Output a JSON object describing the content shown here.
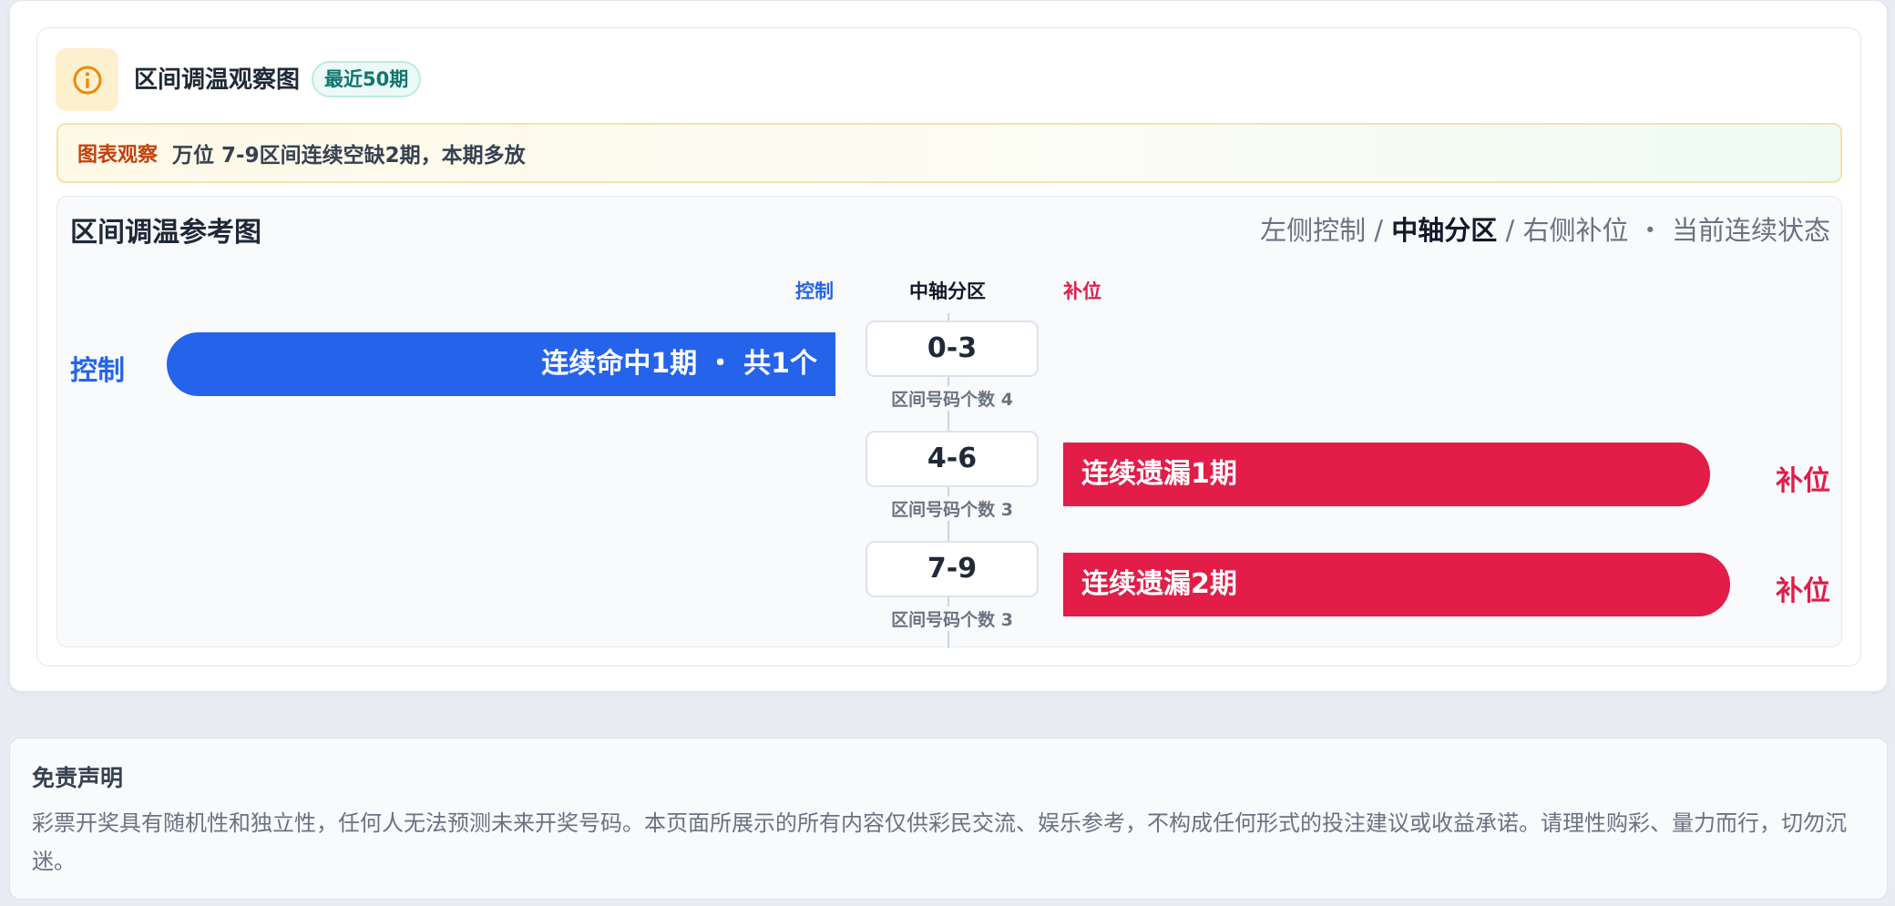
{
  "header": {
    "title": "区间调温观察图",
    "badge": "最近50期"
  },
  "observation": {
    "label": "图表观察",
    "text": "万位 7-9区间连续空缺2期，本期多放"
  },
  "chart": {
    "title": "区间调温参考图",
    "legend": {
      "left": "左侧控制",
      "sep1": " / ",
      "middle": "中轴分区",
      "sep2": " / ",
      "right": "右侧补位",
      "dot": " ・ ",
      "state": "当前连续状态"
    },
    "column_heads": {
      "control": "控制",
      "axis": "中轴分区",
      "fill": "补位"
    },
    "colors": {
      "control": "#2563eb",
      "fill": "#e11d48"
    }
  },
  "chart_data": {
    "type": "bar",
    "categories": [
      "0-3",
      "4-6",
      "7-9"
    ],
    "rows": [
      {
        "range": "0-3",
        "sub": "区间号码个数 4",
        "side": "left",
        "row_label": "控制",
        "bar_text": "连续命中1期 ・ 共1个"
      },
      {
        "range": "4-6",
        "sub": "区间号码个数 3",
        "side": "right",
        "row_label": "补位",
        "bar_text": "连续遗漏1期"
      },
      {
        "range": "7-9",
        "sub": "区间号码个数 3",
        "side": "right",
        "row_label": "补位",
        "bar_text": "连续遗漏2期"
      }
    ]
  },
  "disclaimer": {
    "title": "免责声明",
    "body": "彩票开奖具有随机性和独立性，任何人无法预测未来开奖号码。本页面所展示的所有内容仅供彩民交流、娱乐参考，不构成任何形式的投注建议或收益承诺。请理性购彩、量力而行，切勿沉迷。"
  }
}
